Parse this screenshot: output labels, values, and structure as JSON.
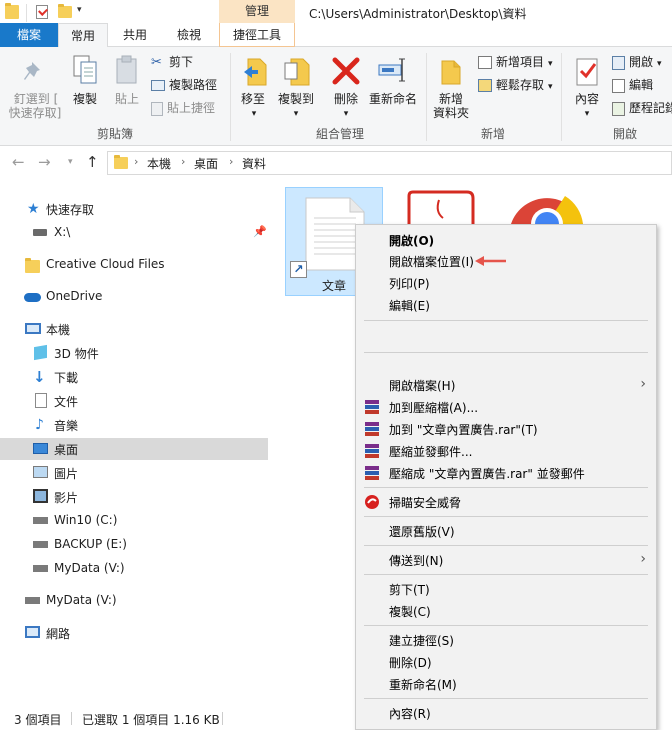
{
  "window": {
    "path": "C:\\Users\\Administrator\\Desktop\\資料",
    "manage_tab": "管理"
  },
  "ribbon_tabs": {
    "file": "檔案",
    "home": "常用",
    "share": "共用",
    "view": "檢視",
    "tools": "捷徑工具"
  },
  "ribbon": {
    "pin_label_1": "釘選到 [",
    "pin_label_2": "快速存取]",
    "copy": "複製",
    "paste": "貼上",
    "cut": "剪下",
    "copy_path": "複製路徑",
    "paste_shortcut": "貼上捷徑",
    "group_clipboard": "剪貼簿",
    "move_to": "移至",
    "copy_to": "複製到",
    "delete": "刪除",
    "rename": "重新命名",
    "group_organize": "組合管理",
    "new_folder_1": "新增",
    "new_folder_2": "資料夾",
    "new_item": "新增項目",
    "easy_access": "輕鬆存取",
    "group_new": "新增",
    "properties": "內容",
    "open": "開啟",
    "edit": "編輯",
    "history": "歷程記錄",
    "group_open": "開啟",
    "dropdown_glyph": "▾"
  },
  "address": {
    "crumbs": [
      "本機",
      "桌面",
      "資料"
    ],
    "sep": "›"
  },
  "nav": {
    "quick_access": "快速存取",
    "x_drive": "X:\\",
    "creative_cloud": "Creative Cloud Files",
    "onedrive": "OneDrive",
    "this_pc": "本機",
    "objects3d": "3D 物件",
    "downloads": "下載",
    "documents": "文件",
    "music": "音樂",
    "desktop": "桌面",
    "pictures": "圖片",
    "videos": "影片",
    "win10": "Win10 (C:)",
    "backup": "BACKUP (E:)",
    "mydata_v1": "MyData (V:)",
    "mydata_v2": "MyData (V:)",
    "network": "網路"
  },
  "content": {
    "selected_file": "文章"
  },
  "status": {
    "item_count": "3 個項目",
    "selection": "已選取 1 個項目  1.16 KB"
  },
  "context_menu": {
    "open": "開啟(O)",
    "open_location": "開啟檔案位置(I)",
    "print": "列印(P)",
    "edit": "編輯(E)",
    "open_with": "開啟檔案(H)",
    "add_archive": "加到壓縮檔(A)...",
    "add_rar": "加到 \"文章內置廣告.rar\"(T)",
    "compress_email": "壓縮並發郵件...",
    "compress_rar_email": "壓縮成 \"文章內置廣告.rar\" 並發郵件",
    "scan": "掃瞄安全威脅",
    "restore": "還原舊版(V)",
    "send_to": "傳送到(N)",
    "cut": "剪下(T)",
    "copy": "複製(C)",
    "create_shortcut": "建立捷徑(S)",
    "delete": "刪除(D)",
    "rename": "重新命名(M)",
    "properties": "內容(R)",
    "submenu_arrow": "›"
  },
  "colors": {
    "file_tab": "#1979ca",
    "selection": "#cce8ff",
    "annotation_arrow": "#e5544b",
    "manage_tab": "#fbe4c4"
  }
}
